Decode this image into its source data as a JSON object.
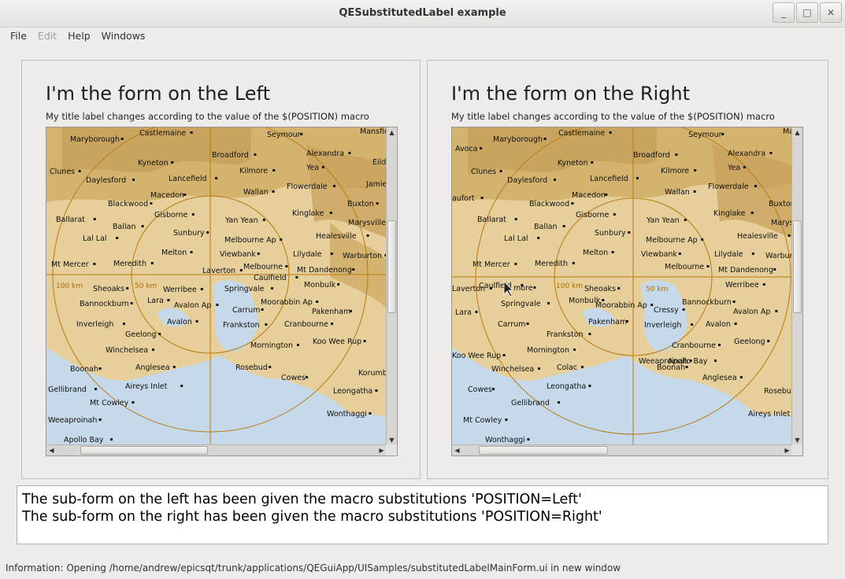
{
  "window": {
    "title": "QESubstitutedLabel example",
    "buttons": [
      "_",
      "□",
      "✕"
    ]
  },
  "menu": [
    {
      "label": "File",
      "enabled": true
    },
    {
      "label": "Edit",
      "enabled": false
    },
    {
      "label": "Help",
      "enabled": true
    },
    {
      "label": "Windows",
      "enabled": true
    }
  ],
  "left_panel": {
    "title": "I'm the form on the Left",
    "subtitle": "My title label changes according to the value of the $(POSITION) macro",
    "map_labels": [
      "Castlemaine",
      "Seymour",
      "Mansfie",
      "Maryborough",
      "Broadford",
      "Alexandra",
      "Eildo",
      "Clunes",
      "Kyneton",
      "Kilmore",
      "Yea",
      "Daylesford",
      "Lancefield",
      "Jamie",
      "Macedon",
      "Wallan",
      "Flowerdale",
      "Blackwood",
      "Gisborne",
      "Buxton",
      "Ballarat",
      "Yan Yean",
      "Kinglake",
      "Marysville",
      "Ballan",
      "Sunbury",
      "Healesville",
      "Lal Lal",
      "Melbourne Ap",
      "Melton",
      "Viewbank",
      "Lilydale",
      "Warburton",
      "Mt Mercer",
      "Meredith",
      "Melbourne",
      "Mt Dandenong",
      "Laverton",
      "Caulfield",
      "100 km",
      "50 km",
      "Sheoaks",
      "Werribee",
      "Springvale",
      "Monbulk",
      "Bannockburn",
      "Lara",
      "Moorabbin Ap",
      "Pakenham",
      "Avalon Ap",
      "Carrum",
      "Inverleigh",
      "Avalon",
      "Frankston",
      "Cranbourne",
      "Geelong",
      "Mornington",
      "Koo Wee Rup",
      "Winchelsea",
      "Boonah",
      "Anglesea",
      "Rosebud",
      "Cowes",
      "Korumb",
      "Gellibrand",
      "Aireys Inlet",
      "Leongatha",
      "Mt Cowley",
      "Wonthaggi",
      "Weeaproinah",
      "Apollo Bay"
    ]
  },
  "right_panel": {
    "title": "I'm the form on the Right",
    "subtitle": "My title label changes according to the value of the $(POSITION) macro",
    "map_labels": [
      "Castlemaine",
      "Seymour",
      "Ma",
      "Avoca",
      "Maryborough",
      "Broadford",
      "Alexandra",
      "Clunes",
      "Kyneton",
      "Kilmore",
      "Yea",
      "Daylesford",
      "Lancefield",
      "aufort",
      "Macedon",
      "Wallan",
      "Flowerdale",
      "Blackwood",
      "Gisborne",
      "Buxton",
      "Ballarat",
      "Yan Yean",
      "Kinglake",
      "Marys",
      "Ballan",
      "Sunbury",
      "Healesville",
      "Lal Lal",
      "Melbourne Ap",
      "Melton",
      "Viewbank",
      "Lilydale",
      "Warbur",
      "Mt Mercer",
      "Meredith",
      "Melbourne",
      "Mt Dandenong",
      "Laverton",
      "Caulfield",
      "more",
      "100 km",
      "Sheoaks",
      "50 km",
      "Werribee",
      "Springvale",
      "Monbulk",
      "Bannockburn",
      "Lara",
      "Moorabbin Ap",
      "Cressy",
      "Avalon Ap",
      "Carrum",
      "Pakenham",
      "Inverleigh",
      "Avalon",
      "Frankston",
      "Cranbourne",
      "Geelong",
      "Mornington",
      "Koo Wee Rup",
      "Winchelsea",
      "Colac",
      "Boonah",
      "Anglesea",
      "Rosebud",
      "Cowes",
      "Leongatha",
      "Gellibrand",
      "Aireys Inlet",
      "Mt Cowley",
      "Wonthaggi",
      "Weeaproinah",
      "Apollo Bay"
    ]
  },
  "info": {
    "line1": "The sub-form on the left has been given the macro substitutions 'POSITION=Left'",
    "line2": "The sub-form on the right has been given the macro substitutions 'POSITION=Right'"
  },
  "status": "Information: Opening /home/andrew/epicsqt/trunk/applications/QEGuiApp/UISamples/substitutedLabelMainForm.ui in new window",
  "colors": {
    "land": "#e6cf9a",
    "hills": "#caa35c",
    "sea": "#c5d9ea",
    "range_ring": "#b87a10",
    "window_bg": "#edeceb"
  }
}
